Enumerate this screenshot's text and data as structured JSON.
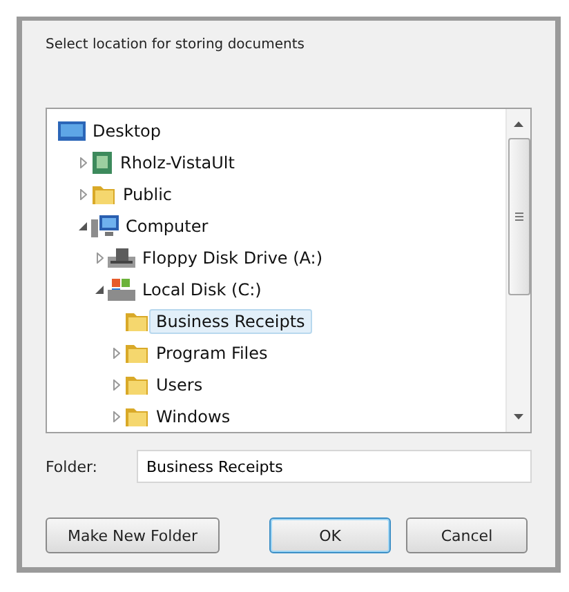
{
  "dialog": {
    "prompt": "Select location for storing documents"
  },
  "tree": [
    {
      "label": "Desktop",
      "kind": "desktop",
      "expandable": false,
      "expanded": true,
      "selected": false,
      "children": [
        {
          "label": "Rholz-VistaUlt",
          "kind": "user",
          "expandable": true,
          "expanded": false,
          "selected": false
        },
        {
          "label": "Public",
          "kind": "folder",
          "expandable": true,
          "expanded": false,
          "selected": false
        },
        {
          "label": "Computer",
          "kind": "computer",
          "expandable": true,
          "expanded": true,
          "selected": false,
          "children": [
            {
              "label": "Floppy Disk Drive (A:)",
              "kind": "floppy",
              "expandable": true,
              "expanded": false,
              "selected": false
            },
            {
              "label": "Local Disk (C:)",
              "kind": "disk",
              "expandable": true,
              "expanded": true,
              "selected": false,
              "children": [
                {
                  "label": "Business Receipts",
                  "kind": "folder",
                  "expandable": false,
                  "expanded": false,
                  "selected": true
                },
                {
                  "label": "Program Files",
                  "kind": "folder",
                  "expandable": true,
                  "expanded": false,
                  "selected": false
                },
                {
                  "label": "Users",
                  "kind": "folder",
                  "expandable": true,
                  "expanded": false,
                  "selected": false
                },
                {
                  "label": "Windows",
                  "kind": "folder",
                  "expandable": true,
                  "expanded": false,
                  "selected": false
                }
              ]
            }
          ]
        }
      ]
    }
  ],
  "folder": {
    "label": "Folder:",
    "value": "Business Receipts"
  },
  "buttons": [
    {
      "label": "Make New Folder",
      "kind": "secondary"
    },
    {
      "label": "OK",
      "kind": "default"
    },
    {
      "label": "Cancel",
      "kind": "secondary"
    }
  ]
}
